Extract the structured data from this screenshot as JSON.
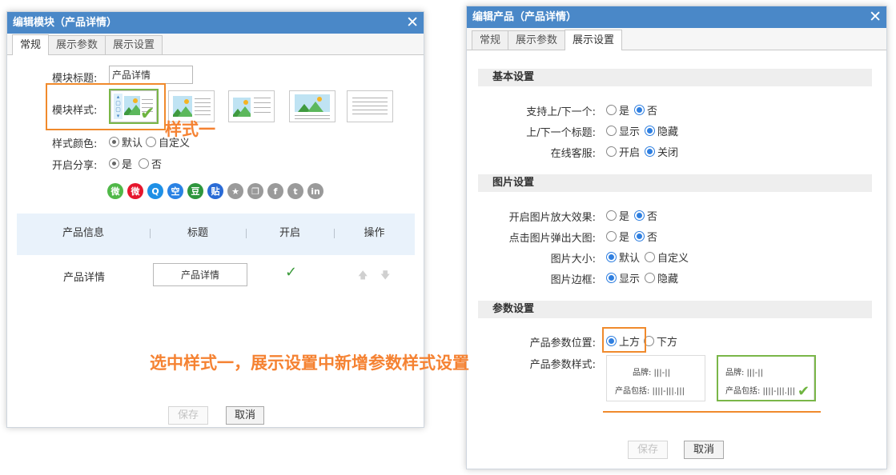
{
  "left_dialog": {
    "title": "编辑模块（产品详情）",
    "close": "✕",
    "tabs": [
      "常规",
      "展示参数",
      "展示设置"
    ],
    "module_title_label": "模块标题:",
    "module_title_value": "产品详情",
    "module_style_label": "模块样式:",
    "style_color_label": "样式颜色:",
    "style_color_options": [
      "默认",
      "自定义"
    ],
    "share_label": "开启分享:",
    "share_options": [
      "是",
      "否"
    ],
    "socials": [
      {
        "name": "wechat-icon",
        "glyph": "微",
        "color": "#50b848"
      },
      {
        "name": "weibo-icon",
        "glyph": "微",
        "color": "#e6162d"
      },
      {
        "name": "qq-icon",
        "glyph": "Q",
        "color": "#1e90e6"
      },
      {
        "name": "qzone-icon",
        "glyph": "空",
        "color": "#2a82e4"
      },
      {
        "name": "douban-icon",
        "glyph": "豆",
        "color": "#2e963d"
      },
      {
        "name": "tieba-icon",
        "glyph": "贴",
        "color": "#2a6bd6"
      },
      {
        "name": "star-icon",
        "glyph": "★",
        "color": "#9a9a9a"
      },
      {
        "name": "copy-icon",
        "glyph": "❐",
        "color": "#9a9a9a"
      },
      {
        "name": "facebook-icon",
        "glyph": "f",
        "color": "#9a9a9a"
      },
      {
        "name": "tumblr-icon",
        "glyph": "t",
        "color": "#9a9a9a"
      },
      {
        "name": "linkedin-icon",
        "glyph": "in",
        "color": "#9a9a9a"
      }
    ],
    "table_headers": [
      "产品信息",
      "标题",
      "开启",
      "操作"
    ],
    "table_row": {
      "name": "产品详情",
      "title": "产品详情",
      "enabled": "✓",
      "up": "🡅",
      "down": "🡇"
    },
    "save": "保存",
    "cancel": "取消"
  },
  "annotation_style1": "样式一",
  "annotation_main": "选中样式一，展示设置中新增参数样式设置",
  "right_dialog": {
    "title": "编辑产品（产品详情）",
    "close": "✕",
    "tabs": [
      "常规",
      "展示参数",
      "展示设置"
    ],
    "basic_section": "基本设置",
    "basic_rows": [
      {
        "label": "支持上/下一个:",
        "options": [
          "是",
          "否"
        ],
        "selected": 1
      },
      {
        "label": "上/下一个标题:",
        "options": [
          "显示",
          "隐藏"
        ],
        "selected": 1
      },
      {
        "label": "在线客服:",
        "options": [
          "开启",
          "关闭"
        ],
        "selected": 1
      }
    ],
    "image_section": "图片设置",
    "image_rows": [
      {
        "label": "开启图片放大效果:",
        "options": [
          "是",
          "否"
        ],
        "selected": 1
      },
      {
        "label": "点击图片弹出大图:",
        "options": [
          "是",
          "否"
        ],
        "selected": 1
      },
      {
        "label": "图片大小:",
        "options": [
          "默认",
          "自定义"
        ],
        "selected": 0
      },
      {
        "label": "图片边框:",
        "options": [
          "显示",
          "隐藏"
        ],
        "selected": 0
      }
    ],
    "param_section": "参数设置",
    "param_position_label": "产品参数位置:",
    "param_position_options": [
      "上方",
      "下方"
    ],
    "param_style_label": "产品参数样式:",
    "param_style_boxes": [
      {
        "line1": "品牌: |||-||",
        "line2": "产品包括: ||||-|||.|||"
      },
      {
        "line1": "品牌: |||-||",
        "line2": "产品包括: ||||-|||.|||"
      }
    ],
    "save": "保存",
    "cancel": "取消"
  },
  "colors": {
    "title_bar": "#4a88c8",
    "accent_orange": "#f08a2c",
    "accent_green": "#7ab648",
    "radio_blue": "#2f7fe0"
  }
}
